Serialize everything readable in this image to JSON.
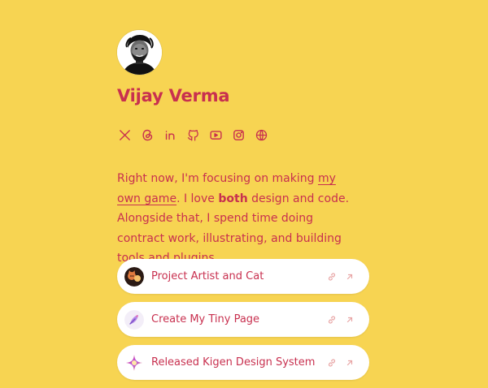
{
  "profile": {
    "name": "Vijay Verma"
  },
  "socials": [
    {
      "icon": "x-icon"
    },
    {
      "icon": "threads-icon"
    },
    {
      "icon": "linkedin-icon"
    },
    {
      "icon": "github-icon"
    },
    {
      "icon": "youtube-icon"
    },
    {
      "icon": "instagram-icon"
    },
    {
      "icon": "globe-icon"
    }
  ],
  "bio": {
    "part1": "Right now, I'm focusing on making ",
    "link_text": "my own game",
    "part2": ". I love ",
    "bold": "both",
    "part3": " design and code. Alongside that, I spend time doing contract work, illustrating, and building tools and plugins."
  },
  "links": [
    {
      "label": "Project Artist and Cat",
      "thumb": "cat-avatar-icon"
    },
    {
      "label": "Create My Tiny Page",
      "thumb": "feather-pen-icon"
    },
    {
      "label": "Released Kigen Design System",
      "thumb": "kigen-logo-icon"
    }
  ],
  "colors": {
    "background": "#F7D452",
    "accent": "#C8304F",
    "card": "#FFFFFF",
    "muted_icon": "#E8A4A4"
  }
}
